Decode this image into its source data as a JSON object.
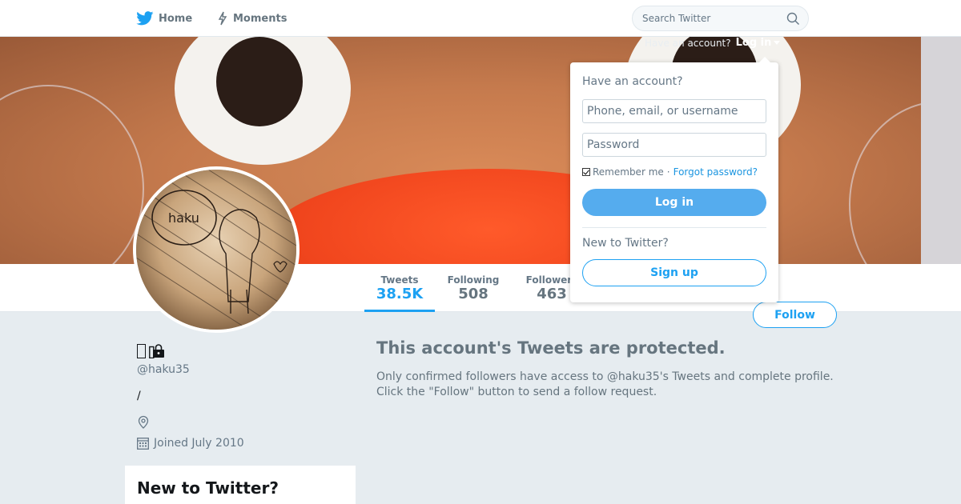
{
  "nav": {
    "home_label": "Home",
    "moments_label": "Moments",
    "search_placeholder": "Search Twitter"
  },
  "login_bar": {
    "prompt": "Have an account?",
    "login_label": "Log in"
  },
  "login_dropdown": {
    "heading": "Have an account?",
    "username_placeholder": "Phone, email, or username",
    "password_placeholder": "Password",
    "remember_label": "Remember me",
    "separator": "·",
    "forgot_label": "Forgot password?",
    "login_button": "Log in",
    "new_heading": "New to Twitter?",
    "signup_button": "Sign up"
  },
  "stats": [
    {
      "label": "Tweets",
      "value": "38.5K",
      "active": true
    },
    {
      "label": "Following",
      "value": "508",
      "active": false
    },
    {
      "label": "Followers",
      "value": "463",
      "active": false
    }
  ],
  "follow_button": "Follow",
  "profile": {
    "handle": "@haku35",
    "bio": "/",
    "joined": "Joined July 2010",
    "avatar_text": "haku"
  },
  "protected": {
    "title": "This account's Tweets are protected.",
    "body": "Only confirmed followers have access to @haku35's Tweets and complete profile. Click the \"Follow\" button to send a follow request."
  },
  "new_to_twitter": "New to Twitter?",
  "colors": {
    "brand": "#1da1f2",
    "login_button": "#55acee",
    "background": "#e6ecf0"
  },
  "icons": [
    "twitter-bird-icon",
    "moments-icon",
    "search-icon",
    "caret-down-icon",
    "lock-icon",
    "location-icon",
    "calendar-icon"
  ]
}
